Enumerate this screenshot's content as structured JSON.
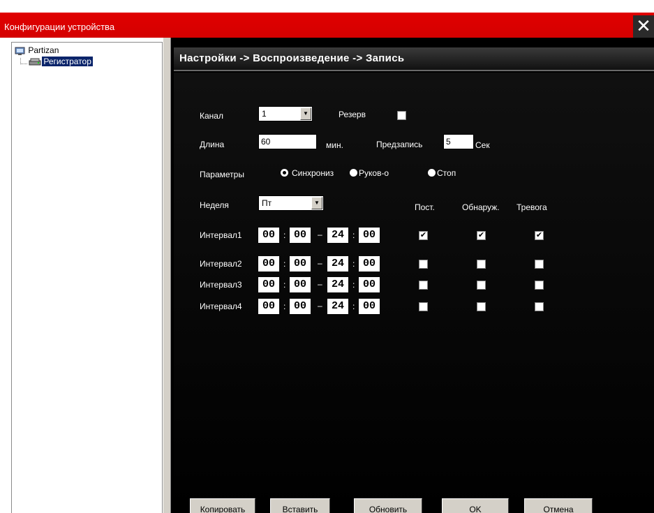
{
  "window": {
    "title": "Конфигурации устройства",
    "close_glyph": "✕"
  },
  "tree": {
    "root_label": "Partizan",
    "child_label": "Регистратор"
  },
  "panel": {
    "breadcrumb": "Настройки -> Воспроизведение -> Запись"
  },
  "form": {
    "channel_label": "Канал",
    "channel_value": "1",
    "reserve_label": "Резерв",
    "reserve_checked": false,
    "length_label": "Длина",
    "length_value": "60",
    "length_unit": "мин.",
    "prerecord_label": "Предзапись",
    "prerecord_value": "5",
    "prerecord_unit": "Сек",
    "params_label": "Параметры",
    "mode_options": [
      "Синхрониз",
      "Руков-о",
      "Стоп"
    ],
    "mode_selected": "Синхрониз",
    "week_label": "Неделя",
    "week_value": "Пт",
    "col_headers": [
      "Пост.",
      "Обнаруж.",
      "Тревога"
    ]
  },
  "intervals": [
    {
      "label": "Интервал1",
      "start_h": "00",
      "start_m": "00",
      "end_h": "24",
      "end_m": "00",
      "checks": [
        true,
        true,
        true
      ]
    },
    {
      "label": "Интервал2",
      "start_h": "00",
      "start_m": "00",
      "end_h": "24",
      "end_m": "00",
      "checks": [
        false,
        false,
        false
      ]
    },
    {
      "label": "Интервал3",
      "start_h": "00",
      "start_m": "00",
      "end_h": "24",
      "end_m": "00",
      "checks": [
        false,
        false,
        false
      ]
    },
    {
      "label": "Интервал4",
      "start_h": "00",
      "start_m": "00",
      "end_h": "24",
      "end_m": "00",
      "checks": [
        false,
        false,
        false
      ]
    }
  ],
  "time_sep": ":",
  "range_sep": "–",
  "buttons": {
    "copy": "Копировать",
    "paste": "Вставить",
    "refresh": "Обновить",
    "ok": "OK",
    "cancel": "Отмена"
  },
  "colors": {
    "titlebar": "#d40000",
    "panel_bg": "#000000",
    "tree_selection": "#0a246a"
  }
}
